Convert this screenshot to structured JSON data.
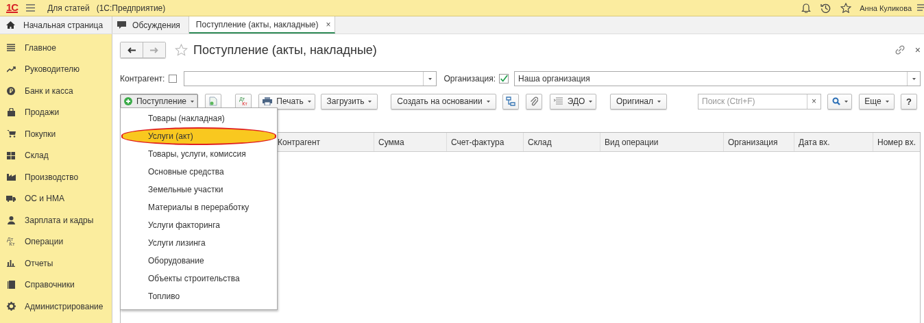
{
  "app": {
    "logo": "1С",
    "title": "Для статей",
    "subtitle": "(1С:Предприятие)",
    "user": "Анна Куликова"
  },
  "tabs": [
    {
      "label": "Начальная страница",
      "selected": false
    },
    {
      "label": "Обсуждения",
      "selected": false
    },
    {
      "label": "Поступление (акты, накладные)",
      "selected": true,
      "close": "×"
    }
  ],
  "sidebar": {
    "items": [
      {
        "label": "Главное"
      },
      {
        "label": "Руководителю"
      },
      {
        "label": "Банк и касса"
      },
      {
        "label": "Продажи"
      },
      {
        "label": "Покупки"
      },
      {
        "label": "Склад"
      },
      {
        "label": "Производство"
      },
      {
        "label": "ОС и НМА"
      },
      {
        "label": "Зарплата и кадры"
      },
      {
        "label": "Операции",
        "icon_labels": [
          "Дт",
          "Кт"
        ]
      },
      {
        "label": "Отчеты"
      },
      {
        "label": "Справочники"
      },
      {
        "label": "Администрирование"
      }
    ]
  },
  "form": {
    "title": "Поступление (акты, накладные)",
    "close": "×",
    "filters": [
      {
        "label": "Контрагент:",
        "checked": false
      },
      {
        "label": "Организация:",
        "checked": true,
        "value": "Наша организация"
      }
    ],
    "toolbar": [
      {
        "kind": "menu",
        "label": "Поступление",
        "pressed": true
      },
      {
        "kind": "icon"
      },
      {
        "kind": "dtkt",
        "labels": [
          "Дт",
          "Кт"
        ]
      },
      {
        "kind": "menu",
        "label": "Печать",
        "pressed": false
      },
      {
        "kind": "menu",
        "label": "Загрузить",
        "pressed": false
      },
      {
        "kind": "menu",
        "label": "Создать на основании",
        "pressed": false
      },
      {
        "kind": "icon"
      },
      {
        "kind": "icon"
      },
      {
        "kind": "menu",
        "label": "ЭДО",
        "pressed": false
      },
      {
        "kind": "menu",
        "label": "Оригинал",
        "pressed": false
      },
      {
        "kind": "search",
        "placeholder": "Поиск (Ctrl+F)",
        "clear": "×"
      },
      {
        "kind": "icon"
      },
      {
        "kind": "menu",
        "label": "Еще",
        "pressed": false
      },
      {
        "kind": "help",
        "label": "?"
      }
    ],
    "table": {
      "columns": [
        "Контрагент",
        "Сумма",
        "Счет-фактура",
        "Склад",
        "Вид операции",
        "Организация",
        "Дата вх.",
        "Номер вх."
      ]
    },
    "menu": {
      "items": [
        {
          "label": "Товары (накладная)",
          "selected": false
        },
        {
          "label": "Услуги (акт)",
          "selected": true
        },
        {
          "label": "Товары, услуги, комиссия",
          "selected": false
        },
        {
          "label": "Основные средства",
          "selected": false
        },
        {
          "label": "Земельные участки",
          "selected": false
        },
        {
          "label": "Материалы в переработку",
          "selected": false
        },
        {
          "label": "Услуги факторинга",
          "selected": false
        },
        {
          "label": "Услуги лизинга",
          "selected": false
        },
        {
          "label": "Оборудование",
          "selected": false
        },
        {
          "label": "Объекты строительства",
          "selected": false
        },
        {
          "label": "Топливо",
          "selected": false
        }
      ]
    }
  }
}
